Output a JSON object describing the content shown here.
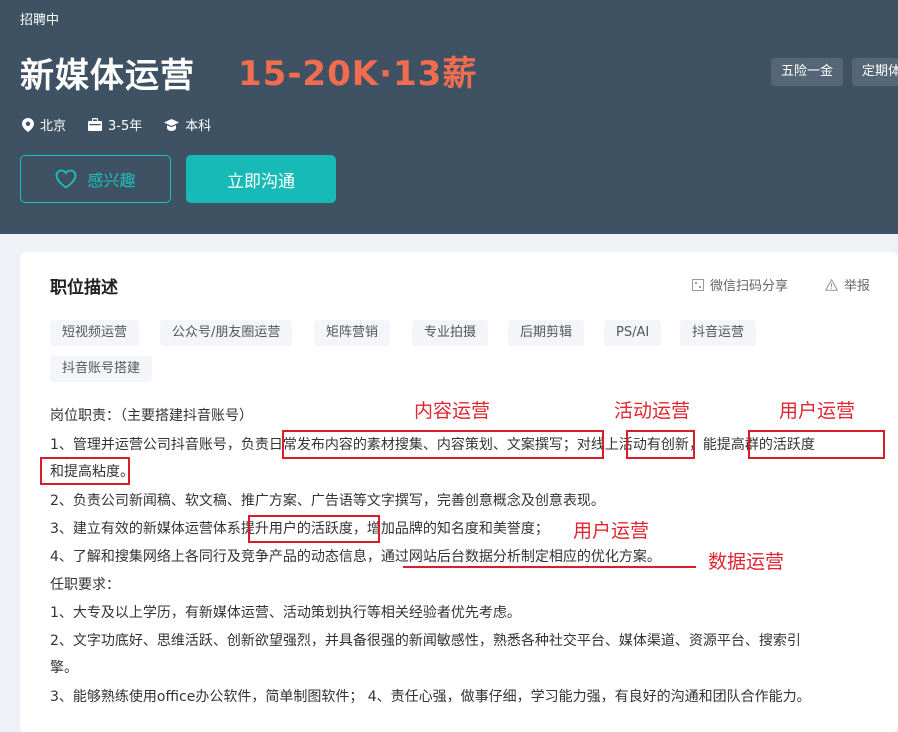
{
  "header": {
    "status": "招聘中",
    "title": "新媒体运营",
    "salary": "15-20K·13薪",
    "benefits": [
      "五险一金",
      "定期体"
    ],
    "location": "北京",
    "experience": "3-5年",
    "education": "本科",
    "interest_label": "感兴趣",
    "chat_label": "立即沟通"
  },
  "section": {
    "title": "职位描述",
    "share_label": "微信扫码分享",
    "report_label": "举报"
  },
  "tags": [
    "短视频运营",
    "公众号/朋友圈运营",
    "矩阵营销",
    "专业拍摄",
    "后期剪辑",
    "PS/AI",
    "抖音运营",
    "抖音账号搭建"
  ],
  "description": {
    "line1": "岗位职责：（主要搭建抖音账号）",
    "line2": "1、管理并运营公司抖音账号，负责日常发布内容的素材搜集、内容策划、文案撰写；对线上活动有创新，能提高群的活跃度",
    "line3": "和提高粘度。",
    "line4": "2、负责公司新闻稿、软文稿、推广方案、广告语等文字撰写，完善创意概念及创意表现。",
    "line5": "3、建立有效的新媒体运营体系提升用户的活跃度，增加品牌的知名度和美誉度；",
    "line6": "4、了解和搜集网络上各同行及竞争产品的动态信息，通过网站后台数据分析制定相应的优化方案。",
    "line7": "任职要求：",
    "line8": "1、大专及以上学历，有新媒体运营、活动策划执行等相关经验者优先考虑。",
    "line9": "2、文字功底好、思维活跃、创新欲望强烈，并具备很强的新闻敏感性，熟悉各种社交平台、媒体渠道、资源平台、搜索引",
    "line10": "擎。",
    "line11": "3、能够熟练使用office办公软件，简单制图软件； 4、责任心强，做事仔细，学习能力强，有良好的沟通和团队合作能力。"
  },
  "annotations": {
    "content_ops": "内容运营",
    "activity_ops": "活动运营",
    "user_ops_1": "用户运营",
    "user_ops_2": "用户运营",
    "data_ops": "数据运营"
  },
  "colors": {
    "header_bg": "#3e5264",
    "salary": "#f26d50",
    "accent": "#18bab7",
    "annotation": "#d61f2b"
  }
}
